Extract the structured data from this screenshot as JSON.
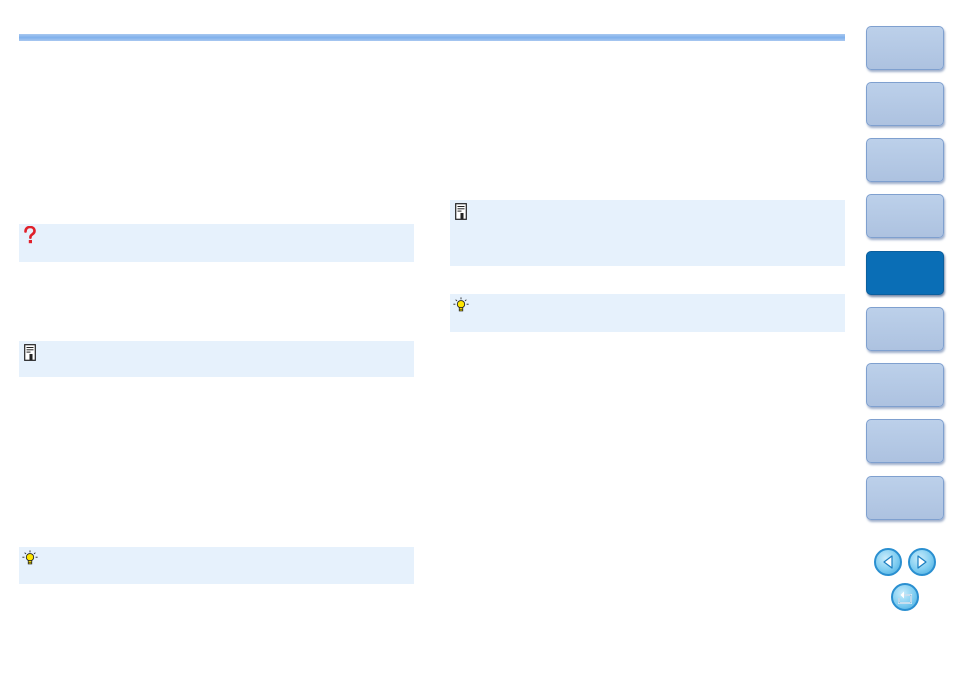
{
  "header": {
    "bar_color": "#8ab6ee"
  },
  "note_boxes": [
    {
      "kind": "troubleshooting",
      "icon": "question-mark-icon",
      "color": "#e6f1fc"
    },
    {
      "kind": "memo",
      "icon": "memo-icon",
      "color": "#e6f1fc"
    },
    {
      "kind": "tip",
      "icon": "lightbulb-icon",
      "color": "#e6f1fc"
    },
    {
      "kind": "memo",
      "icon": "memo-icon",
      "color": "#e6f1fc"
    },
    {
      "kind": "tip",
      "icon": "lightbulb-icon",
      "color": "#e6f1fc"
    }
  ],
  "sidebar": {
    "tab_color": "#b3c7e4",
    "active_tab_color": "#0a6eb6",
    "active_index": 4,
    "tab_count": 9
  },
  "navigation": {
    "previous_icon": "arrow-left-icon",
    "next_icon": "arrow-right-icon",
    "return_icon": "return-icon"
  }
}
